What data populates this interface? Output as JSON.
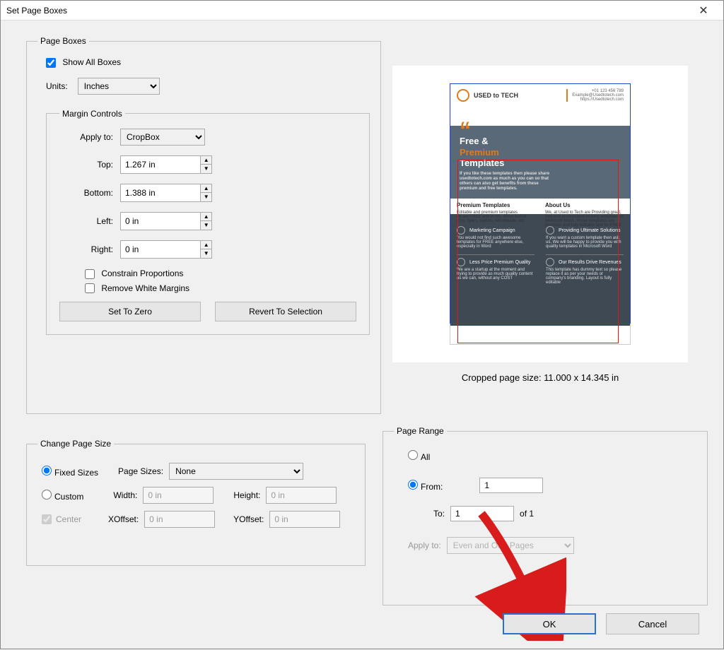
{
  "window": {
    "title": "Set Page Boxes"
  },
  "pageBoxes": {
    "legend": "Page Boxes",
    "showAllBoxes_label": "Show All Boxes",
    "units_label": "Units:",
    "units_value": "Inches",
    "marginControls": {
      "legend": "Margin Controls",
      "applyTo_label": "Apply to:",
      "applyTo_value": "CropBox",
      "top_label": "Top:",
      "top_value": "1.267 in",
      "bottom_label": "Bottom:",
      "bottom_value": "1.388 in",
      "left_label": "Left:",
      "left_value": "0 in",
      "right_label": "Right:",
      "right_value": "0 in",
      "constrain_label": "Constrain Proportions",
      "removeWhite_label": "Remove White Margins",
      "setToZero_label": "Set To Zero",
      "revert_label": "Revert To Selection"
    }
  },
  "preview": {
    "info": "Cropped page size: 11.000 x 14.345 in",
    "logo": "USED to TECH",
    "contact1": "+01 123 456 789",
    "contact2": "Example@Usedtotech.com",
    "contact3": "https://Usedtotech.com",
    "hero1": "Free &",
    "hero2": "Premium",
    "hero3": "Templates",
    "heroSub": "If you like these templates then please share usedtotech.com as much as you can so that others can also get benefits from these premium and free templates.",
    "midH1": "Premium Templates",
    "midT1a": "Editable and premium templates",
    "midT1b": "All are FREE and in Ms. Word format",
    "midT1c": "CVs, flyers, reports, letterheads, etc.",
    "midH2": "About Us",
    "midT2": "We, at Used to Tech are Providing great, free and professional looking templates in Microsoft Word. These templates are premium and fully editable and for FREE",
    "cell1h": "Marketing Campaign",
    "cell1t": "You would not find such awesome templates for FREE anywhere else, especially in Word",
    "cell2h": "Providing Ultimate Solutions",
    "cell2t": "If you want a custom template then ask us, We will be happy to provide you with quality templates in Microsoft Word",
    "cell3h": "Less Price Premium Quality",
    "cell3t": "We are a startup at the moment and trying to provide as much quality content as we can, without any COST",
    "cell4h": "Our Results Drive Revenues",
    "cell4t": "This template has dummy text so please replace it as per your needs or company's branding. Layout is fully editable"
  },
  "changePageSize": {
    "legend": "Change Page Size",
    "fixedSizes_label": "Fixed Sizes",
    "pageSizes_label": "Page Sizes:",
    "pageSizes_value": "None",
    "custom_label": "Custom",
    "width_label": "Width:",
    "width_value": "0 in",
    "height_label": "Height:",
    "height_value": "0 in",
    "center_label": "Center",
    "xoffset_label": "XOffset:",
    "xoffset_value": "0 in",
    "yoffset_label": "YOffset:",
    "yoffset_value": "0 in"
  },
  "pageRange": {
    "legend": "Page Range",
    "all_label": "All",
    "from_label": "From:",
    "from_value": "1",
    "to_label": "To:",
    "to_value": "1",
    "of_label": "of 1",
    "applyTo_label": "Apply to:",
    "applyTo_value": "Even and Odd Pages"
  },
  "actions": {
    "ok": "OK",
    "cancel": "Cancel"
  }
}
